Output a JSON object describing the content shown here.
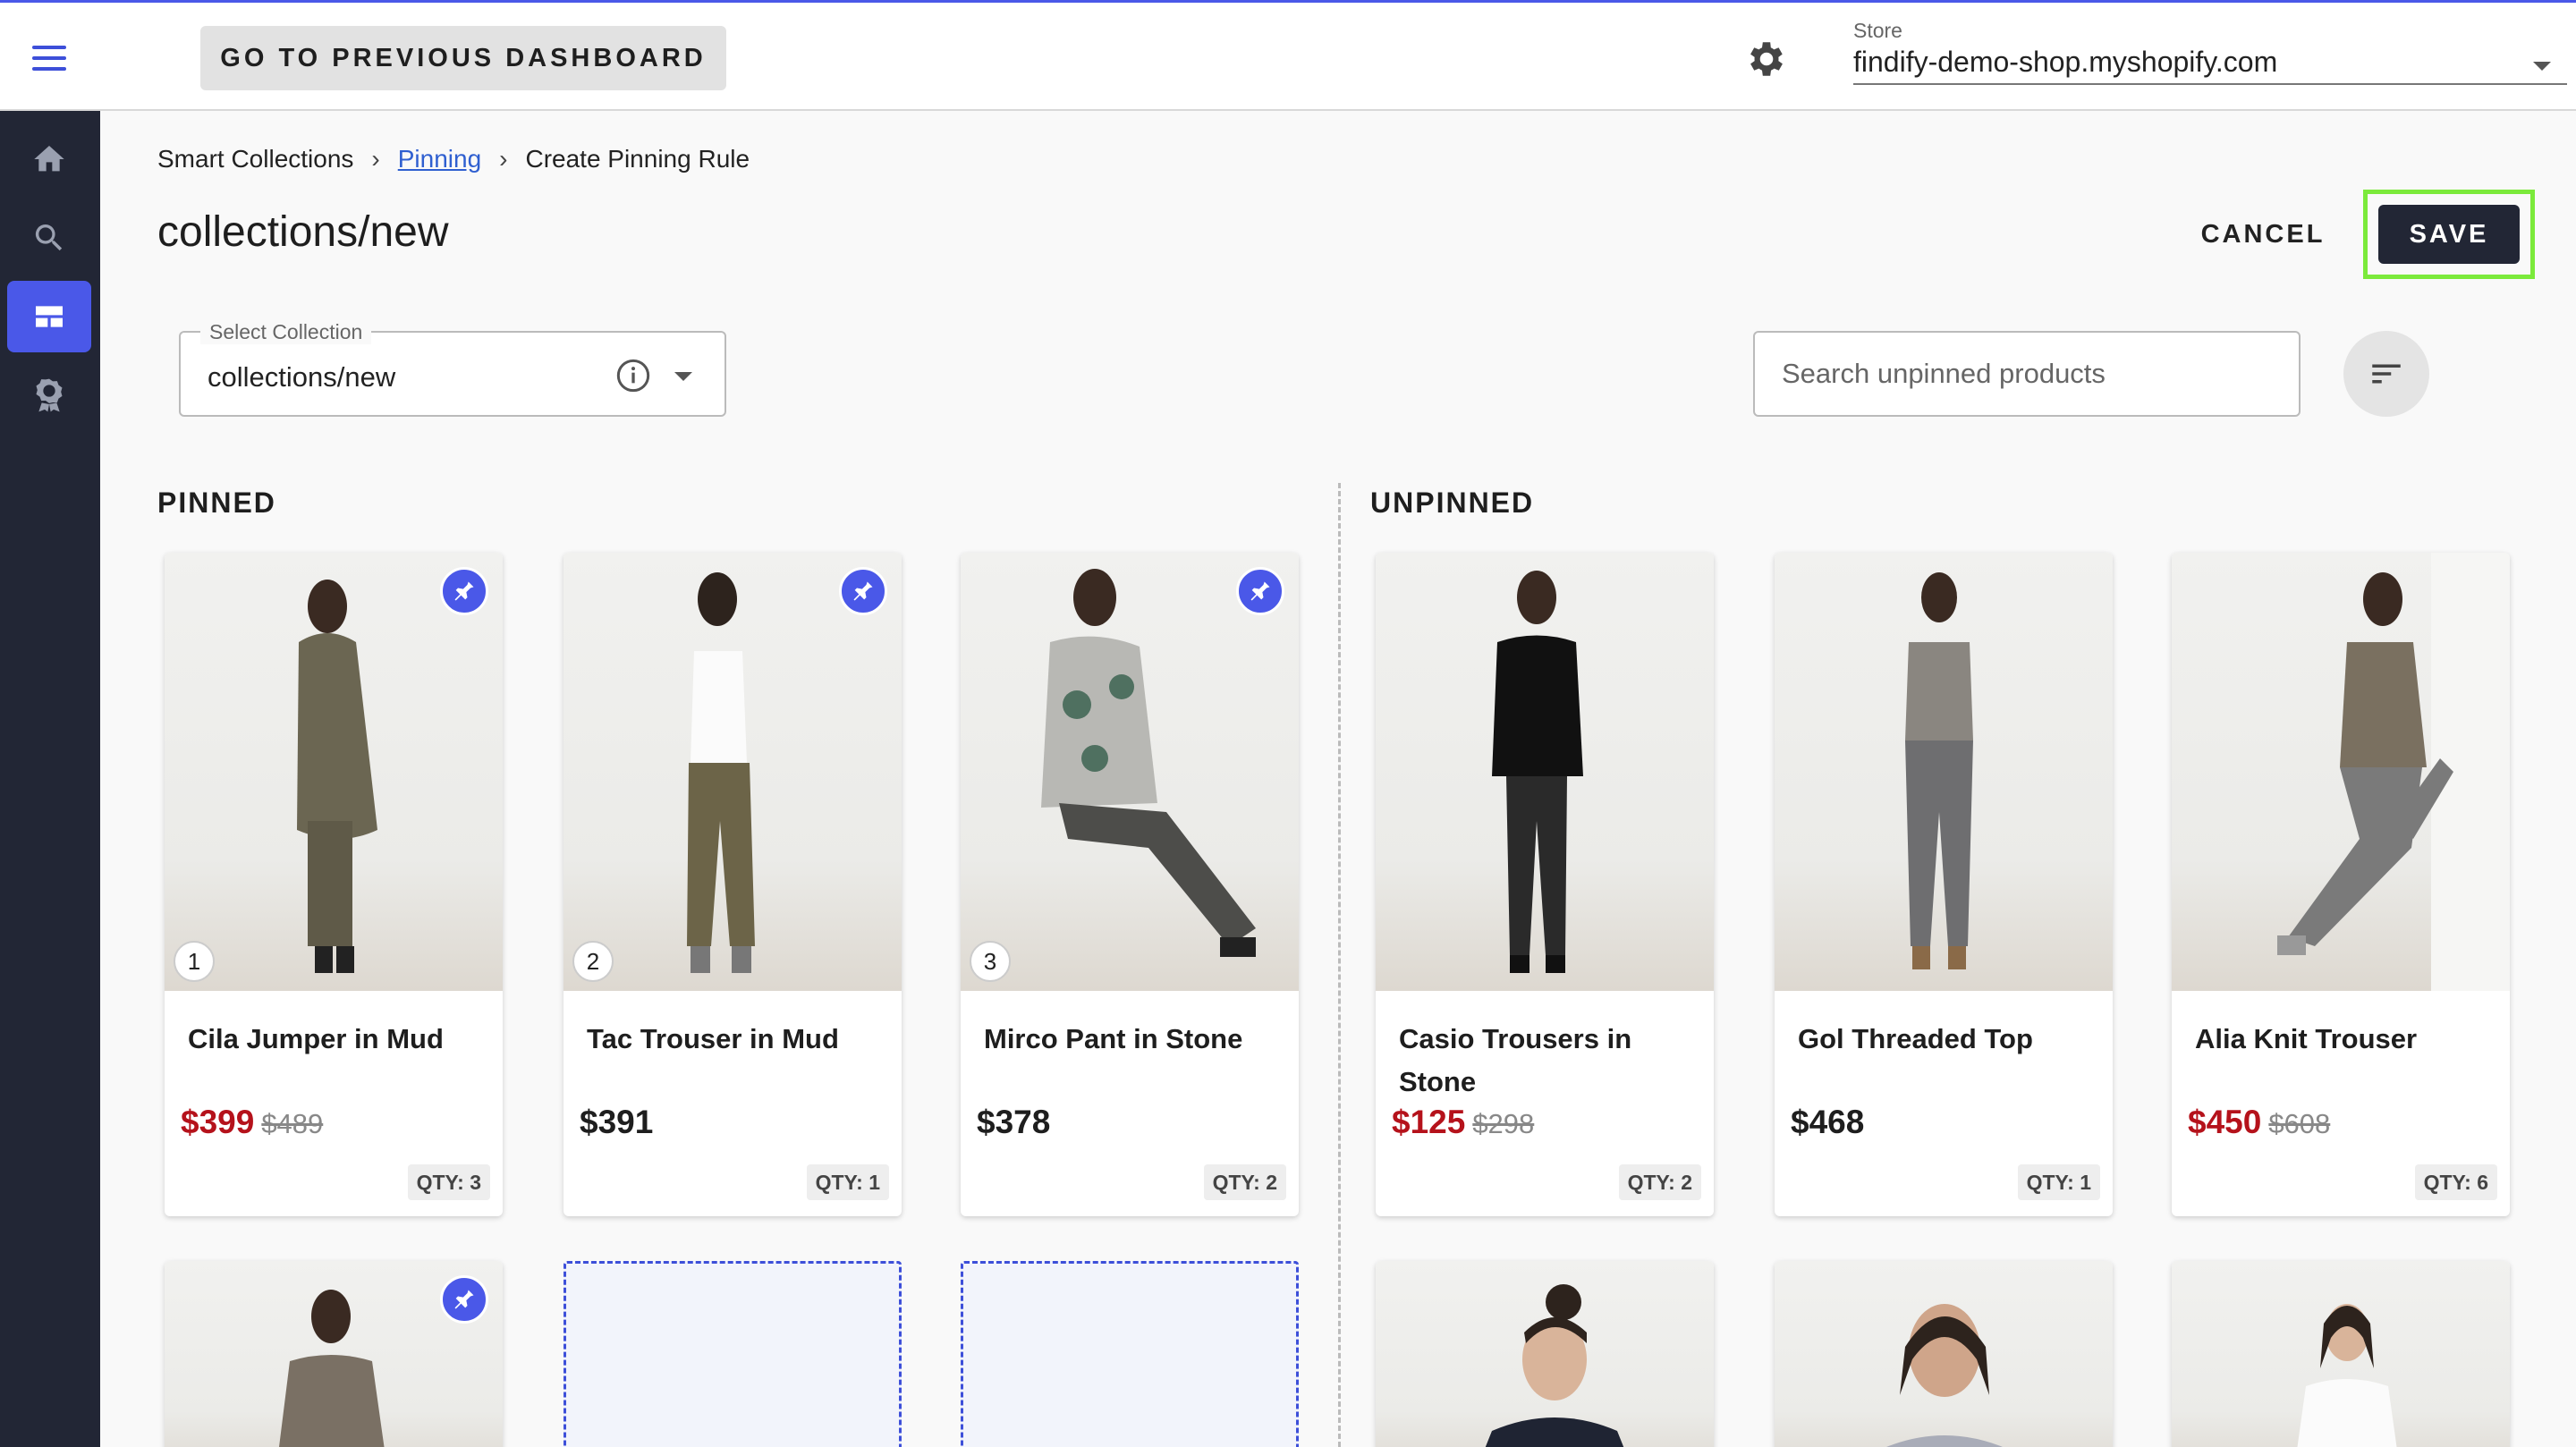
{
  "topbar": {
    "prev_dashboard_label": "GO TO PREVIOUS DASHBOARD",
    "store_label": "Store",
    "store_value": "findify-demo-shop.myshopify.com"
  },
  "sidebar": {
    "items": [
      {
        "icon": "home-icon"
      },
      {
        "icon": "search-icon"
      },
      {
        "icon": "layout-icon",
        "active": true
      },
      {
        "icon": "award-icon"
      }
    ]
  },
  "breadcrumb": {
    "root": "Smart Collections",
    "link": "Pinning",
    "current": "Create Pinning Rule"
  },
  "page": {
    "title": "collections/new",
    "cancel_label": "CANCEL",
    "save_label": "SAVE"
  },
  "collection_select": {
    "label": "Select Collection",
    "value": "collections/new"
  },
  "search": {
    "placeholder": "Search unpinned products"
  },
  "sections": {
    "pinned": "PINNED",
    "unpinned": "UNPINNED"
  },
  "colors": {
    "accent": "#4a58e8",
    "sidebar": "#222635",
    "sale": "#b5121b",
    "highlight": "#7bea3b"
  },
  "pinned_products": [
    {
      "position": "1",
      "title": "Cila Jumper in Mud",
      "price": "$399",
      "compare": "$489",
      "qty": "QTY: 3"
    },
    {
      "position": "2",
      "title": "Tac Trouser in Mud",
      "price": "$391",
      "compare": "",
      "qty": "QTY: 1"
    },
    {
      "position": "3",
      "title": "Mirco Pant in Stone",
      "price": "$378",
      "compare": "",
      "qty": "QTY: 2"
    }
  ],
  "unpinned_products": [
    {
      "title": "Casio Trousers in Stone",
      "price": "$125",
      "compare": "$298",
      "qty": "QTY: 2"
    },
    {
      "title": "Gol Threaded Top",
      "price": "$468",
      "compare": "",
      "qty": "QTY: 1"
    },
    {
      "title": "Alia Knit Trouser",
      "price": "$450",
      "compare": "$608",
      "qty": "QTY: 6"
    }
  ]
}
